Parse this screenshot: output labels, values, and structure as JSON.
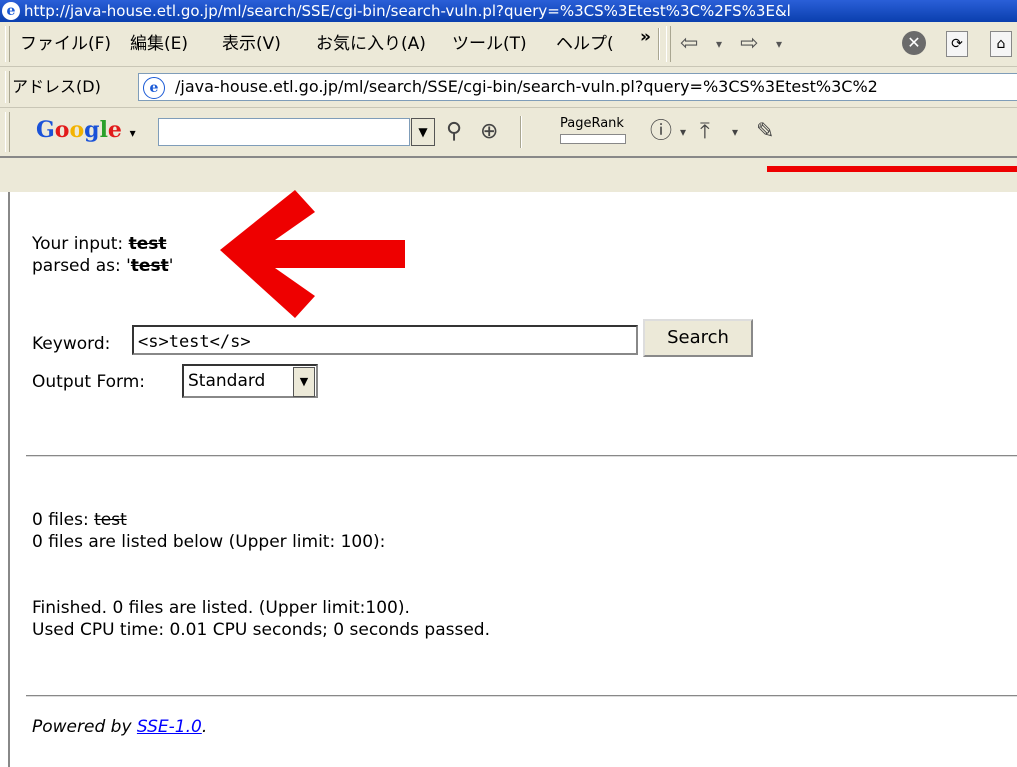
{
  "window": {
    "title_url": "http://java-house.etl.go.jp/ml/search/SSE/cgi-bin/search-vuln.pl?query=%3CS%3Etest%3C%2FS%3E&l"
  },
  "menubar": {
    "items": [
      "ファイル(F)",
      "編集(E)",
      "表示(V)",
      "お気に入り(A)",
      "ツール(T)",
      "ヘルプ("
    ],
    "overflow": "»"
  },
  "addressbar": {
    "label": "アドレス(D)",
    "url": "/java-house.etl.go.jp/ml/search/SSE/cgi-bin/search-vuln.pl?query=%3CS%3Etest%3C%2"
  },
  "googlebar": {
    "logo": "Google",
    "logo_colors": [
      "#1a52d8",
      "#e21b1b",
      "#f3b300",
      "#1a52d8",
      "#2aa12a",
      "#e21b1b"
    ],
    "pagerank_label": "PageRank"
  },
  "page": {
    "input_label": "Your input: ",
    "input_value": "test",
    "parsed_label": "parsed as: '",
    "parsed_value": "test",
    "parsed_end": "'",
    "keyword_label": "Keyword:",
    "keyword_value": "<s>test</s>",
    "search_button": "Search",
    "output_form_label": "Output Form:",
    "output_form_value": "Standard",
    "files_label": "0 files: ",
    "files_value": "test",
    "files_listed": "0 files are listed below (Upper limit: 100):",
    "finished": "Finished. 0 files are listed. (Upper limit:100).",
    "cpu_time": "Used CPU time: 0.01 CPU seconds; 0 seconds passed.",
    "powered_by": "Powered by ",
    "powered_link": "SSE-1.0",
    "powered_end": "."
  },
  "annotation": {
    "arrow_color": "#ee0000"
  }
}
